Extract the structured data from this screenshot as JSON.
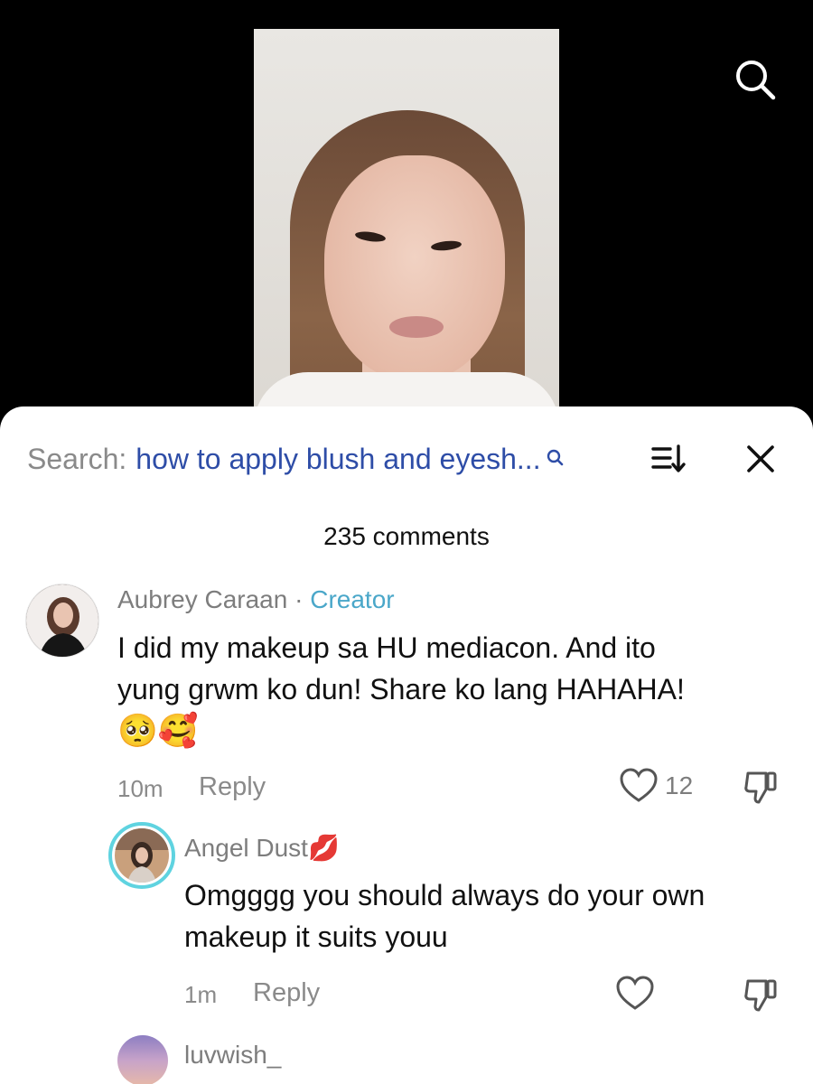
{
  "search": {
    "prefix": "Search:",
    "query": "how to apply blush and eyesh..."
  },
  "comments_count": "235 comments",
  "comments": [
    {
      "username": "Aubrey Caraan",
      "separator": "·",
      "badge": "Creator",
      "text_line1": "I did my makeup sa HU mediacon. And ito",
      "text_line2": "yung grwm ko dun! Share ko lang HAHAHA!",
      "emojis": "🥺🥰",
      "time": "10m",
      "reply_label": "Reply",
      "likes": "12"
    },
    {
      "username": "Angel Dust",
      "username_emoji": "💋",
      "text_line1": "Omgggg you should always do your own",
      "text_line2": "makeup it suits youu",
      "time": "1m",
      "reply_label": "Reply"
    },
    {
      "username": "luvwish_"
    }
  ],
  "icons": {
    "top_search": "search-icon",
    "mini_search": "search-icon",
    "sort": "sort-icon",
    "close": "close-icon",
    "like": "heart-icon",
    "dislike": "thumbs-down-icon"
  },
  "colors": {
    "search_query": "#2e4da7",
    "creator_badge": "#4aa7c9",
    "muted_text": "#8a8a8a",
    "sheet_bg": "#ffffff",
    "screen_bg": "#000000"
  }
}
